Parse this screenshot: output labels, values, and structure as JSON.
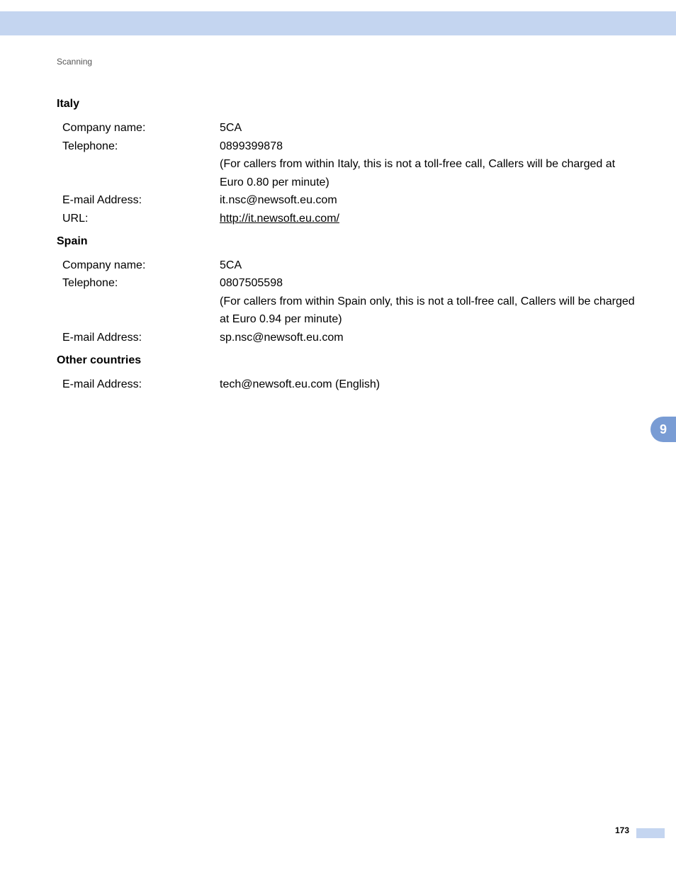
{
  "breadcrumb": "Scanning",
  "chapter_tab": "9",
  "page_number": "173",
  "sections": {
    "italy": {
      "heading": "Italy",
      "company_label": "Company name:",
      "company_value": "5CA",
      "telephone_label": "Telephone:",
      "telephone_value": "0899399878",
      "telephone_note": "(For callers from within Italy, this is not a toll-free call, Callers will be charged at Euro 0.80 per minute)",
      "email_label": "E-mail Address:",
      "email_value": "it.nsc@newsoft.eu.com",
      "url_label": "URL:",
      "url_value": "http://it.newsoft.eu.com/"
    },
    "spain": {
      "heading": "Spain",
      "company_label": "Company name:",
      "company_value": "5CA",
      "telephone_label": "Telephone:",
      "telephone_value": "0807505598",
      "telephone_note": "(For callers from within Spain only, this is not a toll-free call, Callers will be charged at Euro 0.94 per minute)",
      "email_label": "E-mail Address:",
      "email_value": "sp.nsc@newsoft.eu.com"
    },
    "other": {
      "heading": "Other countries",
      "email_label": "E-mail Address:",
      "email_value": "tech@newsoft.eu.com (English)"
    }
  }
}
